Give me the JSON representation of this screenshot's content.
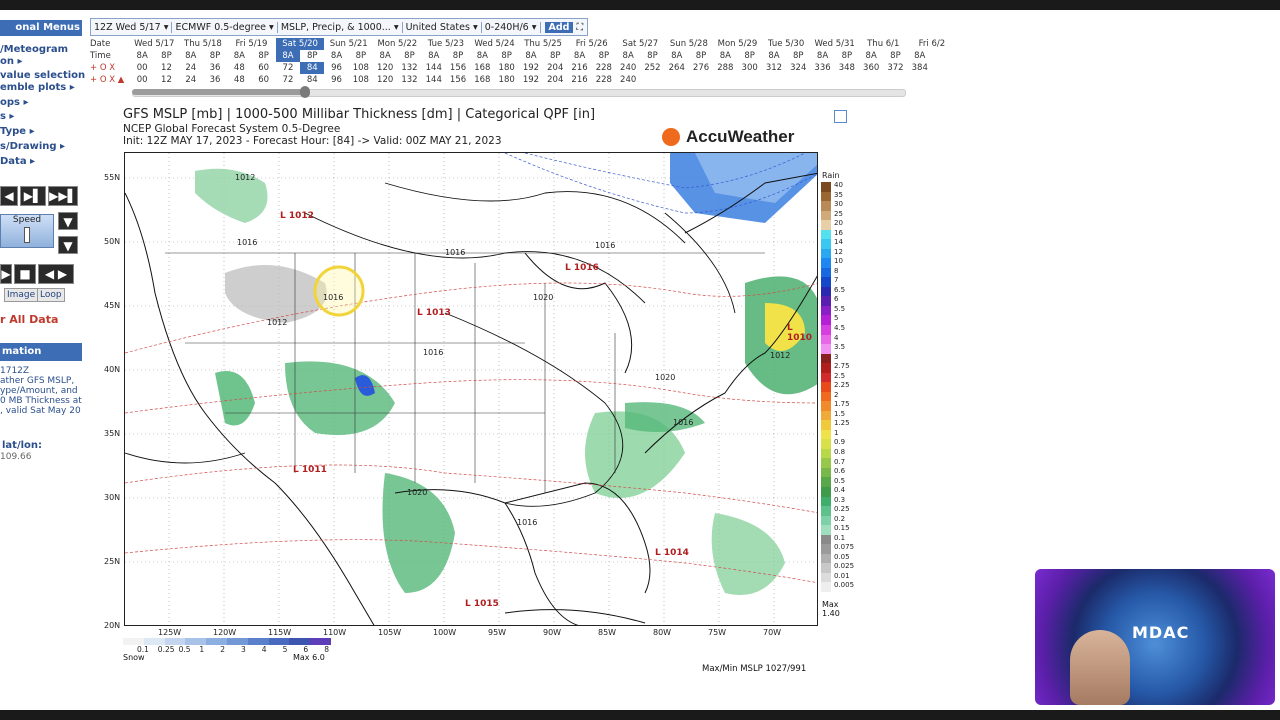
{
  "sidebar": {
    "header": "onal Menus",
    "links": [
      "/Meteogram",
      "on ▸",
      "value selection",
      "emble plots ▸",
      "ops ▸",
      "s ▸",
      "Type ▸",
      "s/Drawing ▸",
      "Data ▸"
    ],
    "speed_label": "Speed",
    "image_tab": "Image",
    "loop_tab": "Loop",
    "clear_all": "r All Data",
    "info_header": "mation",
    "info_lines": [
      "1712Z",
      "ather GFS MSLP,",
      "ype/Amount, and",
      "0 MB Thickness at",
      ", valid Sat May 20"
    ],
    "latlon_label": "lat/lon:",
    "latlon_value": "109.66"
  },
  "toolbar": {
    "items": [
      "12Z Wed 5/17 ▾",
      "ECMWF 0.5-degree ▾",
      "MSLP, Precip, & 1000... ▾",
      "United States ▾",
      "0-240H/6 ▾"
    ],
    "add": "Add",
    "icons": [
      "fullscreen-icon",
      "help-icon"
    ]
  },
  "timeline": {
    "row_labels": [
      "Date",
      "Time"
    ],
    "dates": [
      "Wed 5/17",
      "Thu 5/18",
      "Fri 5/19",
      "Sat 5/20",
      "Sun 5/21",
      "Mon 5/22",
      "Tue 5/23",
      "Wed 5/24",
      "Thu 5/25",
      "Fri 5/26",
      "Sat 5/27",
      "Sun 5/28",
      "Mon 5/29",
      "Tue 5/30",
      "Wed 5/31",
      "Thu 6/1",
      "Fri 6/2"
    ],
    "times": [
      "8A",
      "8P",
      "8A",
      "8P",
      "8A",
      "8P",
      "8A",
      "8P",
      "8A",
      "8P",
      "8A",
      "8P",
      "8A",
      "8P",
      "8A",
      "8P",
      "8A",
      "8P",
      "8A",
      "8P",
      "8A",
      "8P",
      "8A",
      "8P",
      "8A",
      "8P",
      "8A",
      "8P",
      "8A",
      "8P",
      "8A",
      "8P",
      "8A"
    ],
    "row1_prefix": "+ O X",
    "row1": [
      "00",
      "12",
      "24",
      "36",
      "48",
      "60",
      "72",
      "84",
      "96",
      "108",
      "120",
      "132",
      "144",
      "156",
      "168",
      "180",
      "192",
      "204",
      "216",
      "228",
      "240",
      "252",
      "264",
      "276",
      "288",
      "300",
      "312",
      "324",
      "336",
      "348",
      "360",
      "372",
      "384"
    ],
    "row2_prefix": "+ O X ▲",
    "row2": [
      "00",
      "12",
      "24",
      "36",
      "48",
      "60",
      "72",
      "84",
      "96",
      "108",
      "120",
      "132",
      "144",
      "156",
      "168",
      "180",
      "192",
      "204",
      "216",
      "228",
      "240"
    ],
    "selected_date": "Sat 5/20",
    "selected_hour": "84"
  },
  "map": {
    "title": "GFS MSLP [mb] | 1000-500 Millibar Thickness [dm] | Categorical QPF [in]",
    "subtitle": "NCEP Global Forecast System 0.5-Degree",
    "init": "Init: 12Z MAY 17, 2023 - Forecast Hour: [84] -> Valid: 00Z MAY 21, 2023",
    "brand": "AccuWeather",
    "lat_labels": [
      "55N",
      "50N",
      "45N",
      "40N",
      "35N",
      "30N",
      "25N",
      "20N"
    ],
    "lon_labels": [
      "125W",
      "120W",
      "115W",
      "110W",
      "105W",
      "100W",
      "95W",
      "90W",
      "85W",
      "80W",
      "75W",
      "70W"
    ],
    "pressure_labels": [
      {
        "text": "1012",
        "type": "H"
      },
      {
        "text": "1012",
        "type": "L"
      },
      {
        "text": "1016",
        "type": "H"
      },
      {
        "text": "1016",
        "type": "H"
      },
      {
        "text": "1013",
        "type": "L"
      },
      {
        "text": "1016",
        "type": "H"
      },
      {
        "text": "1016",
        "type": "L"
      },
      {
        "text": "1016",
        "type": "H"
      },
      {
        "text": "1020",
        "type": "H"
      },
      {
        "text": "1016",
        "type": "H"
      },
      {
        "text": "1010",
        "type": "L"
      },
      {
        "text": "1012",
        "type": "H"
      },
      {
        "text": "1020",
        "type": "H"
      },
      {
        "text": "1016",
        "type": "H"
      },
      {
        "text": "1011",
        "type": "L"
      },
      {
        "text": "1020",
        "type": "H"
      },
      {
        "text": "1016",
        "type": "H"
      },
      {
        "text": "1014",
        "type": "L"
      },
      {
        "text": "1015",
        "type": "L"
      },
      {
        "text": "1012",
        "type": "H"
      }
    ],
    "legend_title": "Rain",
    "legend_values": [
      "40",
      "35",
      "30",
      "25",
      "20",
      "16",
      "14",
      "12",
      "10",
      "8",
      "7",
      "6.5",
      "6",
      "5.5",
      "5",
      "4.5",
      "4",
      "3.5",
      "3",
      "2.75",
      "2.5",
      "2.25",
      "2",
      "1.75",
      "1.5",
      "1.25",
      "1",
      "0.9",
      "0.8",
      "0.7",
      "0.6",
      "0.5",
      "0.4",
      "0.3",
      "0.25",
      "0.2",
      "0.15",
      "0.1",
      "0.075",
      "0.05",
      "0.025",
      "0.01",
      "0.005"
    ],
    "max_label": "Max",
    "max_value": "1.40",
    "snow_label": "Snow",
    "snow_values": [
      "0.1",
      "0.25",
      "0.5",
      "1",
      "2",
      "3",
      "4",
      "5",
      "6",
      "8"
    ],
    "snow_max": "Max 6.0",
    "maxmin": "Max/Min MSLP 1027/991"
  },
  "webcam": {
    "label": "MDAC"
  },
  "colors": {
    "accent": "#3c6db5",
    "brand_sun": "#f06a1d",
    "rain_green": "#3fae6a",
    "rain_yellow": "#f1e24a"
  }
}
